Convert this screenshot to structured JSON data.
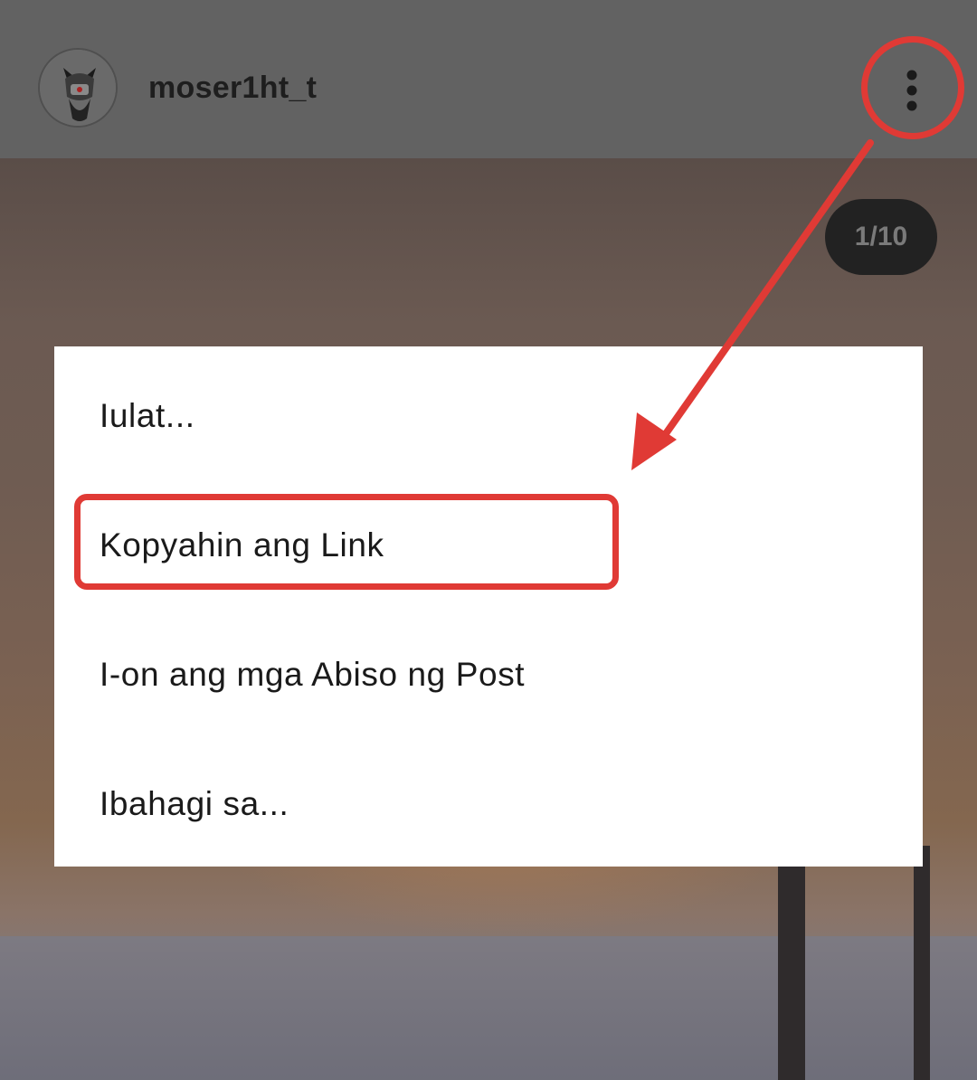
{
  "header": {
    "username": "moser1ht_t",
    "more_icon": "vertical-ellipsis-icon",
    "avatar_icon": "avatar-character-icon"
  },
  "post": {
    "counter": "1/10"
  },
  "menu": {
    "items": [
      {
        "label": "Iulat..."
      },
      {
        "label": "Kopyahin ang Link"
      },
      {
        "label": "I-on ang mga Abiso ng Post"
      },
      {
        "label": "Ibahagi sa..."
      }
    ]
  },
  "annotations": {
    "color": "#e03a35"
  }
}
